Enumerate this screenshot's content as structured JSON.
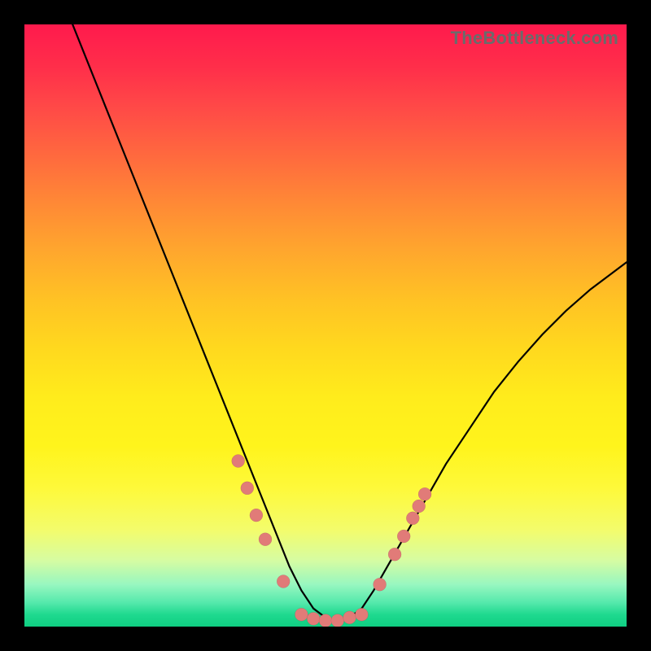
{
  "watermark": "TheBottleneck.com",
  "colors": {
    "curve": "#000000",
    "marker": "#e17b78",
    "plot_bg_top": "#ff1a4d",
    "plot_bg_bottom": "#0fcf82",
    "page_bg": "#000000"
  },
  "chart_data": {
    "type": "line",
    "title": "",
    "xlabel": "",
    "ylabel": "",
    "xlim": [
      0,
      100
    ],
    "ylim": [
      0,
      100
    ],
    "curve": {
      "x": [
        8,
        12,
        16,
        20,
        24,
        28,
        32,
        36,
        40,
        42,
        44,
        46,
        48,
        50,
        52,
        54,
        56,
        58,
        62,
        66,
        70,
        74,
        78,
        82,
        86,
        90,
        94,
        98,
        100
      ],
      "y": [
        100,
        90,
        80,
        70,
        60,
        50,
        40,
        30,
        20,
        15,
        10,
        6,
        3,
        1.5,
        1,
        1.5,
        3,
        6,
        13,
        20,
        27,
        33,
        39,
        44,
        48.5,
        52.5,
        56,
        59,
        60.5
      ]
    },
    "markers": [
      {
        "x": 35.5,
        "y": 27.5
      },
      {
        "x": 37.0,
        "y": 23.0
      },
      {
        "x": 38.5,
        "y": 18.5
      },
      {
        "x": 40.0,
        "y": 14.5
      },
      {
        "x": 43.0,
        "y": 7.5
      },
      {
        "x": 46.0,
        "y": 2.0
      },
      {
        "x": 48.0,
        "y": 1.3
      },
      {
        "x": 50.0,
        "y": 1.0
      },
      {
        "x": 52.0,
        "y": 1.0
      },
      {
        "x": 54.0,
        "y": 1.5
      },
      {
        "x": 56.0,
        "y": 2.0
      },
      {
        "x": 59.0,
        "y": 7.0
      },
      {
        "x": 61.5,
        "y": 12.0
      },
      {
        "x": 63.0,
        "y": 15.0
      },
      {
        "x": 64.5,
        "y": 18.0
      },
      {
        "x": 65.5,
        "y": 20.0
      },
      {
        "x": 66.5,
        "y": 22.0
      }
    ],
    "marker_radius": 8
  }
}
